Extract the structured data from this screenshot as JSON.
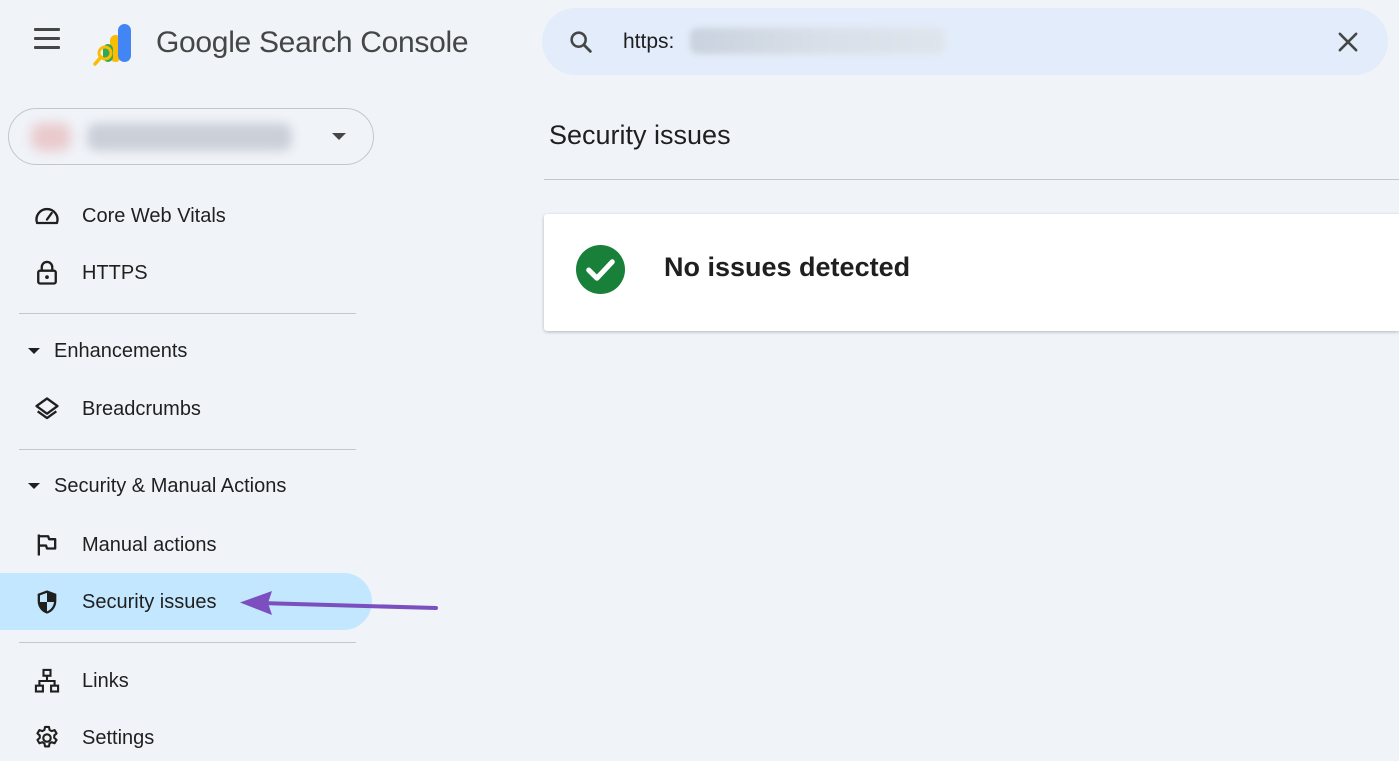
{
  "header": {
    "brand": "Google Search Console",
    "search": {
      "value": "https:"
    }
  },
  "sidebar": {
    "items_top": [
      {
        "label": "Core Web Vitals",
        "icon": "speedometer-icon"
      },
      {
        "label": "HTTPS",
        "icon": "lock-icon"
      }
    ],
    "enhancements": {
      "label": "Enhancements",
      "items": [
        {
          "label": "Breadcrumbs",
          "icon": "layers-icon"
        }
      ]
    },
    "security": {
      "label": "Security & Manual Actions",
      "items": [
        {
          "label": "Manual actions",
          "icon": "flag-icon"
        },
        {
          "label": "Security issues",
          "icon": "shield-icon",
          "active": true
        }
      ]
    },
    "items_bottom": [
      {
        "label": "Links",
        "icon": "sitemap-icon"
      },
      {
        "label": "Settings",
        "icon": "gear-icon"
      }
    ]
  },
  "main": {
    "title": "Security issues",
    "status": {
      "text": "No issues detected",
      "icon": "check-circle-icon",
      "color": "#188038"
    }
  },
  "colors": {
    "background": "#f0f4f9",
    "search_bg": "#e3ecfa",
    "active_nav": "#c2e7ff",
    "annotation_arrow": "#7b4fc0"
  }
}
